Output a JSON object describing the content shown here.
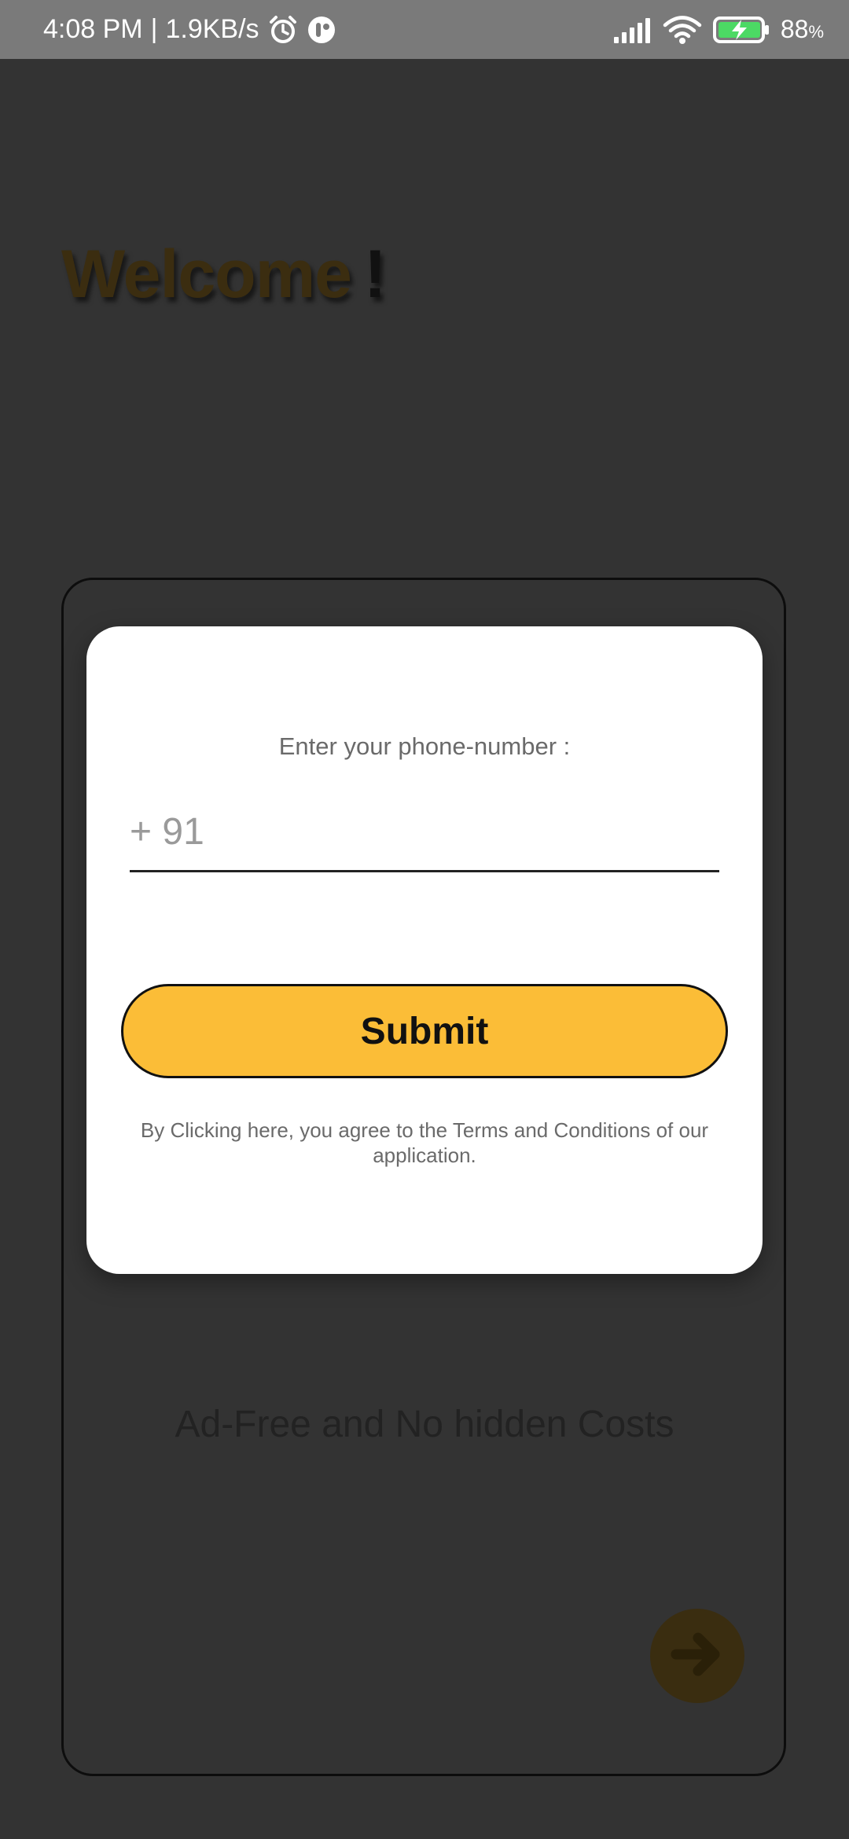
{
  "status_bar": {
    "time": "4:08 PM",
    "separator": "|",
    "speed": "1.9KB/s",
    "battery": "88",
    "battery_unit": "%",
    "icons": [
      "alarm-icon",
      "app-notification-icon",
      "signal-icon",
      "wifi-icon",
      "battery-charging-icon"
    ]
  },
  "welcome": {
    "word": "Welcome",
    "mark": "!"
  },
  "dialog": {
    "prompt": "Enter your phone-number :",
    "phone_placeholder": "+ 91",
    "submit_label": "Submit",
    "terms": "By Clicking here, you agree to the Terms and Conditions of our application."
  },
  "background": {
    "tagline": "Ad-Free and No hidden Costs",
    "next_icon": "arrow-right-circle-icon"
  },
  "colors": {
    "accent": "#fbbd37",
    "dim_background": "#333333",
    "status_bar": "#7a7a7a",
    "battery_green": "#4cd964"
  }
}
